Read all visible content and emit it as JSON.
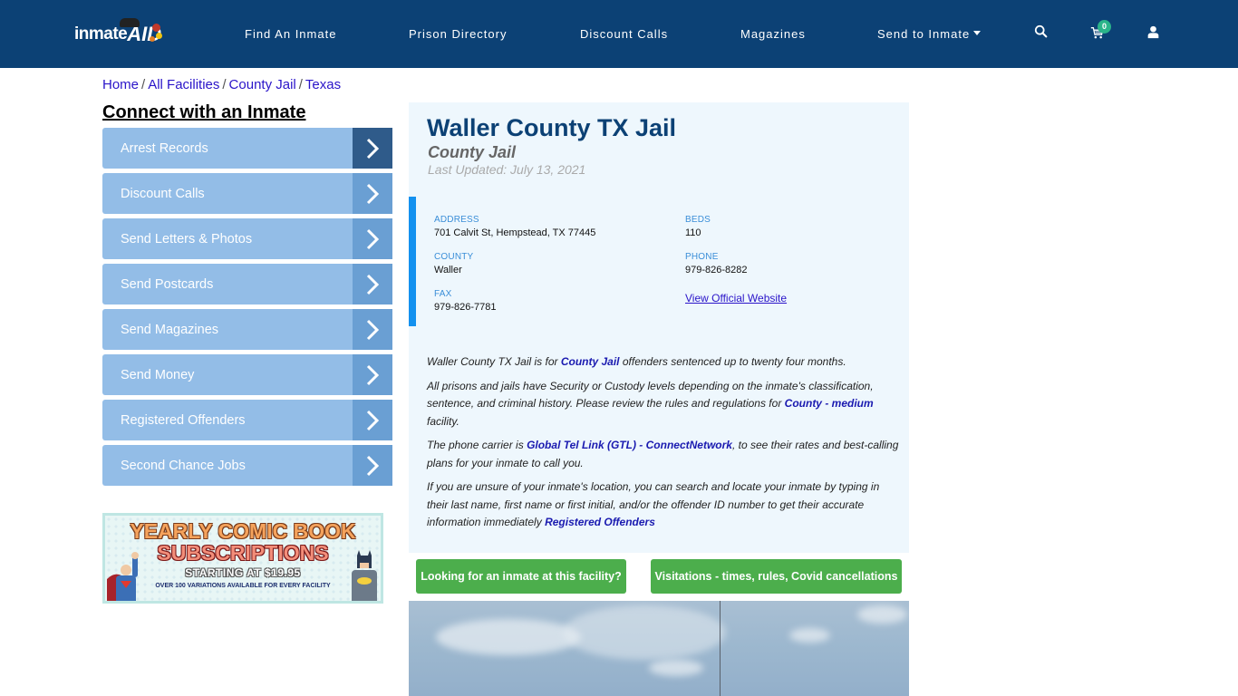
{
  "header": {
    "logo": {
      "text_main": "inmate",
      "text_accent": "AID"
    },
    "nav": [
      {
        "label": "Find An Inmate"
      },
      {
        "label": "Prison Directory"
      },
      {
        "label": "Discount Calls"
      },
      {
        "label": "Magazines"
      },
      {
        "label": "Send to Inmate",
        "has_dropdown": true
      }
    ],
    "icons": {
      "search": "search-icon",
      "cart": "cart-icon",
      "account": "user-icon"
    },
    "cart_count": "0",
    "colors": {
      "bar": "#0c4175",
      "badge": "#2bb48a"
    }
  },
  "breadcrumb": [
    {
      "label": "Home"
    },
    {
      "label": "All Facilities"
    },
    {
      "label": "County Jail"
    },
    {
      "label": "Texas"
    }
  ],
  "sidebar": {
    "title": "Connect with an Inmate",
    "items": [
      {
        "label": "Arrest Records",
        "active": true
      },
      {
        "label": "Discount Calls"
      },
      {
        "label": "Send Letters & Photos"
      },
      {
        "label": "Send Postcards"
      },
      {
        "label": "Send Magazines"
      },
      {
        "label": "Send Money"
      },
      {
        "label": "Registered Offenders"
      },
      {
        "label": "Second Chance Jobs"
      }
    ],
    "ad": {
      "line1": "YEARLY COMIC BOOK",
      "line2": "SUBSCRIPTIONS",
      "line3": "STARTING AT $19.95",
      "line4": "OVER 100 VARIATIONS AVAILABLE FOR EVERY FACILITY"
    }
  },
  "facility": {
    "name": "Waller County TX Jail",
    "type": "County Jail",
    "last_updated": "Last Updated: July 13, 2021",
    "info": {
      "address_label": "ADDRESS",
      "address": "701 Calvit St, Hempstead, TX 77445",
      "beds_label": "BEDS",
      "beds": "110",
      "county_label": "COUNTY",
      "county": "Waller",
      "phone_label": "PHONE",
      "phone": "979-826-8282",
      "fax_label": "FAX",
      "fax": "979-826-7781",
      "website_link": "View Official Website"
    },
    "description": {
      "p1_before": "Waller County TX Jail is for ",
      "p1_link": "County Jail",
      "p1_after": " offenders sentenced up to twenty four months.",
      "p2_before": "All prisons and jails have Security or Custody levels depending on the inmate's classification, sentence, and criminal history. Please review the rules and regulations for ",
      "p2_link": "County - medium",
      "p2_after": " facility.",
      "p3_before": "The phone carrier is ",
      "p3_link": "Global Tel Link (GTL) - ConnectNetwork",
      "p3_after": ", to see their rates and best-calling plans for your inmate to call you.",
      "p4_before": "If you are unsure of your inmate's location, you can search and locate your inmate by typing in their last name, first name or first initial, and/or the offender ID number to get their accurate information immediately ",
      "p4_link": "Registered Offenders"
    },
    "buttons": {
      "find_inmate": "Looking for an inmate at this facility?",
      "visitations": "Visitations - times, rules, Covid cancellations"
    }
  }
}
